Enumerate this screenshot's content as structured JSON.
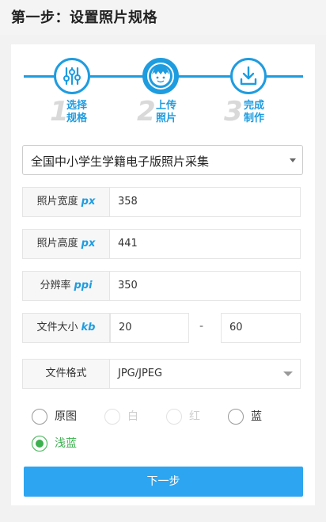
{
  "header": {
    "title": "第一步：设置照片规格"
  },
  "steps": [
    {
      "num": "1",
      "label": "选择规格",
      "icon": "sliders-icon"
    },
    {
      "num": "2",
      "label": "上传照片",
      "icon": "face-icon"
    },
    {
      "num": "3",
      "label": "完成制作",
      "icon": "download-icon"
    }
  ],
  "spec_select": {
    "value": "全国中小学生学籍电子版照片采集"
  },
  "fields": {
    "width": {
      "label": "照片宽度",
      "unit": "px",
      "value": "358"
    },
    "height": {
      "label": "照片高度",
      "unit": "px",
      "value": "441"
    },
    "resolution": {
      "label": "分辨率",
      "unit": "ppi",
      "value": "350"
    },
    "filesize": {
      "label": "文件大小",
      "unit": "kb",
      "min": "20",
      "separator": "-",
      "max": "60"
    },
    "format": {
      "label": "文件格式",
      "value": "JPG/JPEG"
    }
  },
  "background_options": [
    {
      "label": "原图",
      "state": "enabled"
    },
    {
      "label": "白",
      "state": "disabled"
    },
    {
      "label": "红",
      "state": "disabled"
    },
    {
      "label": "蓝",
      "state": "enabled"
    },
    {
      "label": "浅蓝",
      "state": "checked"
    }
  ],
  "next_button": {
    "label": "下一步"
  },
  "colors": {
    "accent": "#1e9ce0",
    "button": "#2da5f0",
    "checked": "#3bb04e"
  }
}
